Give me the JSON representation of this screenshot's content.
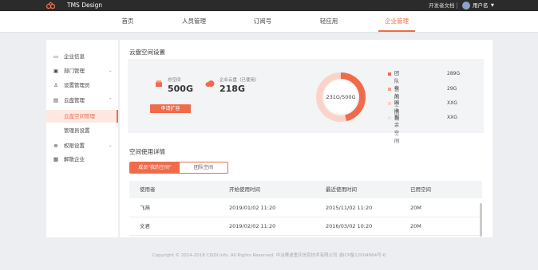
{
  "header": {
    "brand": "TMS Design",
    "dev_docs": "开发者文档",
    "username": "用户名",
    "caret": "▼"
  },
  "nav": {
    "items": [
      {
        "label": "首页"
      },
      {
        "label": "人员管理"
      },
      {
        "label": "订阅号"
      },
      {
        "label": "轻应用"
      },
      {
        "label": "企业管理"
      }
    ]
  },
  "sidebar": {
    "items": [
      {
        "label": "企业信息",
        "icon": "monitor-icon"
      },
      {
        "label": "部门管理",
        "icon": "department-icon",
        "arrow": "⌄"
      },
      {
        "label": "设置管理员",
        "icon": "user-icon"
      },
      {
        "label": "云盘管理",
        "icon": "cloud-drive-icon",
        "arrow": "⌃"
      },
      {
        "label": "云盘空间管理",
        "icon": ""
      },
      {
        "label": "管理员设置",
        "icon": ""
      },
      {
        "label": "权限设置",
        "icon": "permission-icon",
        "arrow": "⌄"
      },
      {
        "label": "解散企业",
        "icon": "dissolve-icon"
      }
    ]
  },
  "storage": {
    "section_title": "云盘空间设置",
    "total_label": "总空间",
    "total_value": "500G",
    "used_label": "企业云盘（已使用）",
    "used_value": "218G",
    "expand_button": "申请扩容",
    "donut_label": "231G/500G",
    "used_fraction": 0.462,
    "legend": [
      {
        "name": "团队空间",
        "value": "289G",
        "color": "#f06b4a"
      },
      {
        "name": "我的空间",
        "value": "29G",
        "color": "#f5a08a"
      },
      {
        "name": "回收站",
        "value": "XXG",
        "color": "#fbd3c8"
      },
      {
        "name": "剩余空间",
        "value": "XXG",
        "color": "#f3f4f6"
      }
    ]
  },
  "usage": {
    "section_title": "空间使用详情",
    "tabs": [
      {
        "label": "成员\"我的空间\""
      },
      {
        "label": "团队空间"
      }
    ],
    "columns": [
      "使用者",
      "开始使用时间",
      "最近使用时间",
      "已用空间"
    ],
    "rows": [
      {
        "user": "飞燕",
        "start": "2019/01/02  11:20",
        "recent": "2015/11/02  11:20",
        "used": "20M"
      },
      {
        "user": "文君",
        "start": "2019/02/02  11:20",
        "recent": "2016/03/02  10:20",
        "used": "20M"
      }
    ]
  },
  "footer": {
    "copyright": "Copyright © 2014-2018 CISDI Info. All Rights Reserved.  中冶赛迪重庆信息技术有限公司 渝ICP备12004864号-6"
  },
  "colors": {
    "accent": "#f06b4a",
    "topbar": "#2b2b2b"
  }
}
